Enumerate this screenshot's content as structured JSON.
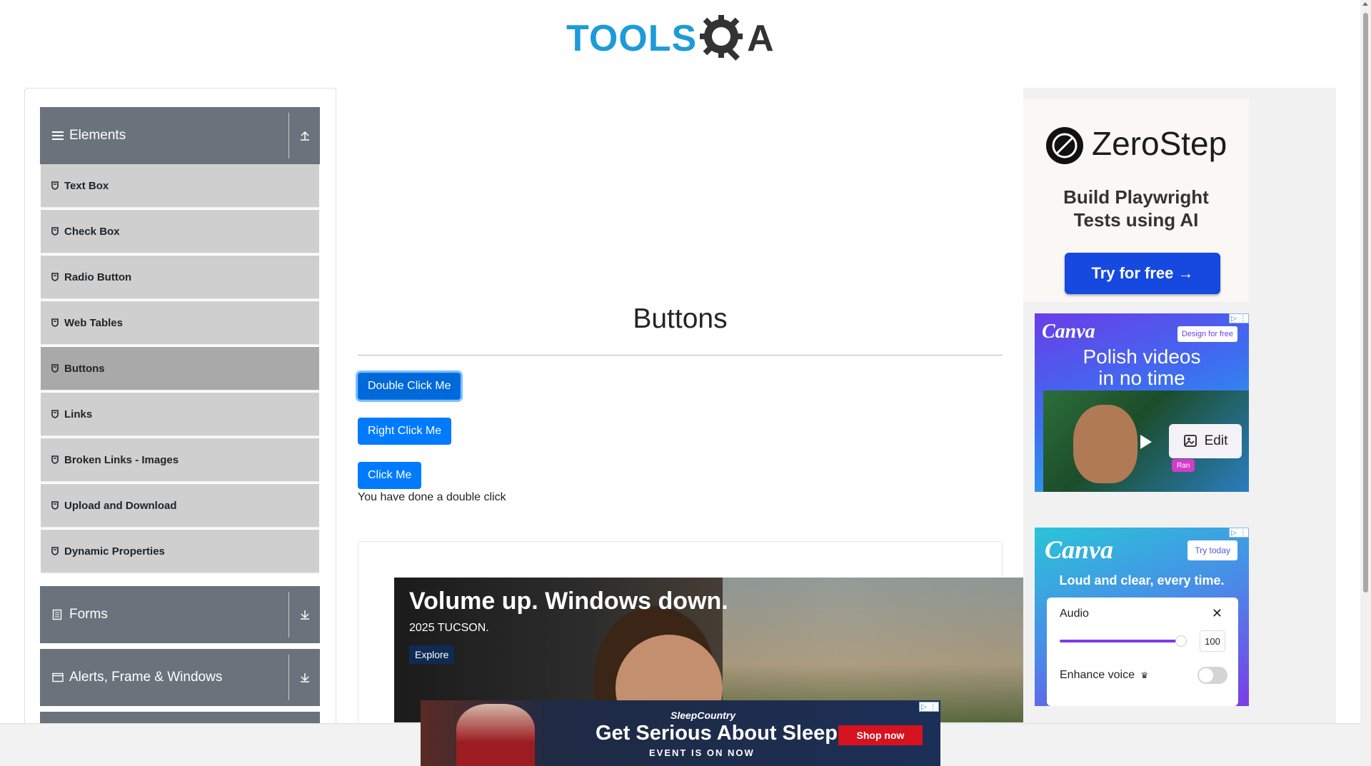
{
  "logo": {
    "tools": "TOOLS",
    "a": "A"
  },
  "sidebar": {
    "groups": [
      {
        "label": "Elements",
        "icon": "hamburger-icon",
        "toggle": "collapse-up-icon"
      },
      {
        "label": "Forms",
        "icon": "document-icon",
        "toggle": "expand-down-icon"
      },
      {
        "label": "Alerts, Frame & Windows",
        "icon": "window-icon",
        "toggle": "expand-down-icon"
      }
    ],
    "items": [
      "Text Box",
      "Check Box",
      "Radio Button",
      "Web Tables",
      "Buttons",
      "Links",
      "Broken Links - Images",
      "Upload and Download",
      "Dynamic Properties"
    ],
    "active_item": "Buttons"
  },
  "main": {
    "title": "Buttons",
    "double_click_label": "Double Click Me",
    "right_click_label": "Right Click Me",
    "click_label": "Click Me",
    "message": "You have done a double click"
  },
  "ads": {
    "car": {
      "headline": "Volume up. Windows down.",
      "sub": "2025 TUCSON.",
      "cta": "Explore"
    },
    "sleep": {
      "brand": "SleepCountry",
      "headline": "Get Serious About Sleep",
      "sub": "EVENT IS ON NOW",
      "cta": "Shop now"
    },
    "zerostep": {
      "name": "ZeroStep",
      "tagline_1": "Build Playwright",
      "tagline_2": "Tests using AI",
      "cta": "Try for free →"
    },
    "canva1": {
      "brand": "Canva",
      "cta": "Design for free",
      "headline_1": "Polish videos",
      "headline_2": "in no time",
      "edit": "Edit",
      "badge": "Ran"
    },
    "canva2": {
      "brand": "Canva",
      "cta": "Try today",
      "headline": "Loud and clear, every time.",
      "audio_title": "Audio",
      "volume": "100",
      "enhance": "Enhance voice"
    }
  },
  "colors": {
    "accent": "#007bff",
    "sidebar_header": "#6a737c",
    "menu_item": "#cfcfcf",
    "menu_active": "#a9a9a9",
    "logo_blue": "#1d9bd8"
  }
}
